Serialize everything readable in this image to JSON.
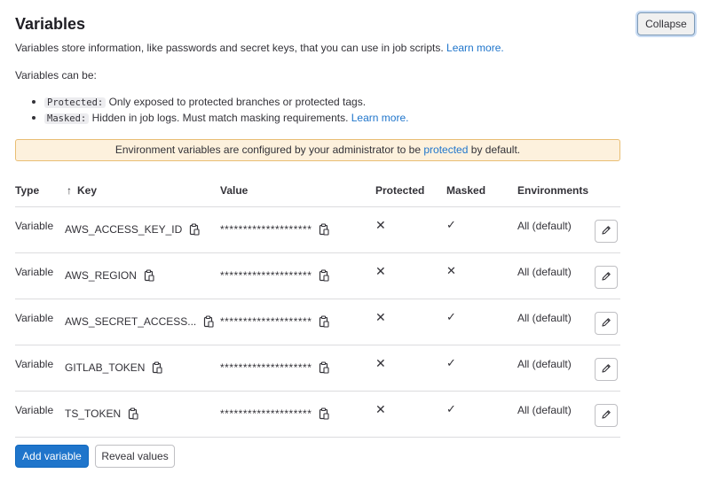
{
  "header": {
    "title": "Variables",
    "collapse_label": "Collapse"
  },
  "description": {
    "text": "Variables store information, like passwords and secret keys, that you can use in job scripts.",
    "link": "Learn more."
  },
  "can_be": "Variables can be:",
  "bullets": [
    {
      "code": "Protected:",
      "text": "Only exposed to protected branches or protected tags.",
      "link": ""
    },
    {
      "code": "Masked:",
      "text": "Hidden in job logs. Must match masking requirements.",
      "link": "Learn more."
    }
  ],
  "alert": {
    "before": "Environment variables are configured by your administrator to be",
    "link": "protected",
    "after": "by default.",
    "bg_color": "#fdf1dd"
  },
  "table": {
    "headers": {
      "type": "Type",
      "sort_arrow": "↑",
      "key": "Key",
      "value": "Value",
      "protected": "Protected",
      "masked": "Masked",
      "environments": "Environments"
    },
    "rows": [
      {
        "type": "Variable",
        "key": "AWS_ACCESS_KEY_ID",
        "value": "********************",
        "protected": "✕",
        "masked": "✓",
        "env": "All (default)"
      },
      {
        "type": "Variable",
        "key": "AWS_REGION",
        "value": "********************",
        "protected": "✕",
        "masked": "✕",
        "env": "All (default)"
      },
      {
        "type": "Variable",
        "key": "AWS_SECRET_ACCESS...",
        "value": "********************",
        "protected": "✕",
        "masked": "✓",
        "env": "All (default)"
      },
      {
        "type": "Variable",
        "key": "GITLAB_TOKEN",
        "value": "********************",
        "protected": "✕",
        "masked": "✓",
        "env": "All (default)"
      },
      {
        "type": "Variable",
        "key": "TS_TOKEN",
        "value": "********************",
        "protected": "✕",
        "masked": "✓",
        "env": "All (default)"
      }
    ]
  },
  "footer": {
    "add_label": "Add variable",
    "reveal_label": "Reveal values",
    "accent_color": "#1f75cb"
  },
  "icons": {
    "copy": "copy-to-clipboard-icon",
    "edit": "pencil-icon"
  }
}
